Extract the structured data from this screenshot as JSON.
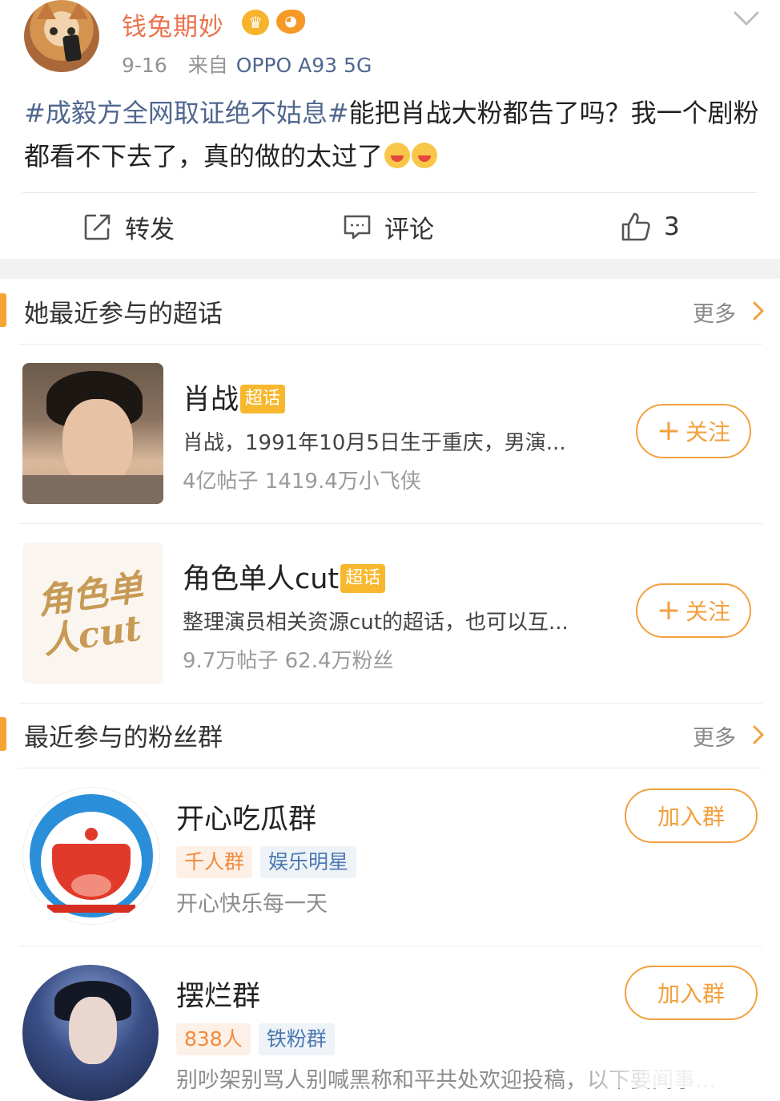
{
  "post": {
    "username": "钱兔期妙",
    "date": "9-16",
    "source_prefix": "来自",
    "source_device": "OPPO A93 5G",
    "hashtag": "#成毅方全网取证绝不姑息#",
    "text": "能把肖战大粉都告了吗？我一个剧粉都看不下去了，真的做的太过了",
    "actions": {
      "repost_label": "转发",
      "comment_label": "评论",
      "like_count": "3"
    }
  },
  "super_topics": {
    "title": "她最近参与的超话",
    "more_label": "更多",
    "items": [
      {
        "name": "肖战",
        "tag": "超话",
        "desc": "肖战，1991年10月5日生于重庆，男演...",
        "stats": "4亿帖子 1419.4万小飞侠",
        "follow_label": "关注"
      },
      {
        "name": "角色单人cut",
        "tag": "超话",
        "thumb_text": "角色单人cut",
        "desc": "整理演员相关资源cut的超话，也可以互...",
        "stats": "9.7万帖子 62.4万粉丝",
        "follow_label": "关注"
      }
    ]
  },
  "fan_groups": {
    "title": "最近参与的粉丝群",
    "more_label": "更多",
    "items": [
      {
        "name": "开心吃瓜群",
        "chip1": "千人群",
        "chip2": "娱乐明星",
        "desc": "开心快乐每一天",
        "join_label": "加入群"
      },
      {
        "name": "摆烂群",
        "chip1": "838人",
        "chip2": "铁粉群",
        "desc": "别吵架别骂人别喊黑称和平共处欢迎投稿，以下要闻事...",
        "join_label": "加入群"
      }
    ]
  },
  "icons": {
    "verified_badge": "crown-badge-icon",
    "fan_badge": "fish-badge-icon",
    "menu": "chevron-down-icon",
    "repost": "repost-icon",
    "comment": "comment-icon",
    "like": "thumbs-up-icon",
    "more": "chevron-right-icon"
  },
  "colors": {
    "username": "#eb7350",
    "link": "#50678f",
    "accent": "#f3a03e",
    "section_bar": "#f6a434",
    "tag_chaohua": "#f7b72e"
  }
}
